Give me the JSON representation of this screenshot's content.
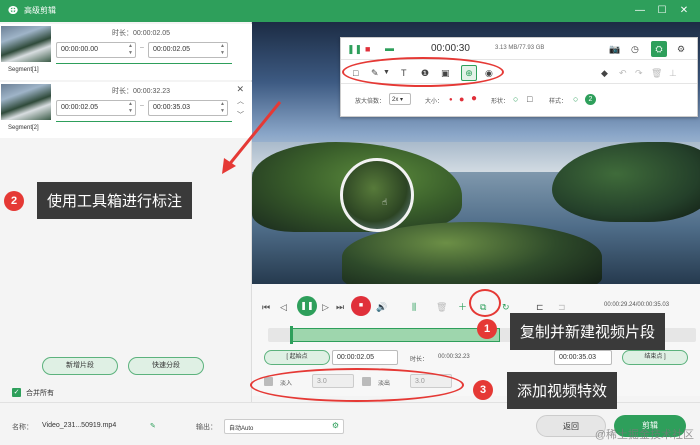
{
  "window": {
    "title": "高级剪辑"
  },
  "segments": [
    {
      "label": "Segment[1]",
      "duration_label": "时长：",
      "duration": "00:00:02.05",
      "start": "00:00:00.00",
      "end": "00:00:02.05"
    },
    {
      "label": "Segment[2]",
      "duration_label": "时长：",
      "duration": "00:00:32.23",
      "start": "00:00:02.05",
      "end": "00:00:35.03"
    }
  ],
  "left_buttons": {
    "new_segment": "新增片段",
    "quick_split": "快速分段"
  },
  "merge_all": "合并所有",
  "recorder": {
    "time": "00:00:30",
    "size": "3.13 MB/77.93 GB"
  },
  "annotation_options": {
    "zoom_label": "放大倍数：",
    "zoom_value": "2x",
    "size_label": "大小：",
    "shape_label": "形状：",
    "style_label": "样式：",
    "style_value": "2"
  },
  "playback": {
    "timecode": "00:00:29.24/00:00:35.03"
  },
  "trim": {
    "start_button": "起始点",
    "start_value": "00:00:02.05",
    "duration_label": "时长：",
    "duration_value": "00:00:32.23",
    "end_value": "00:00:35.03",
    "end_button": "结束点"
  },
  "effects": {
    "fade_in": "淡入",
    "fade_in_value": "3.0",
    "fade_out": "淡出",
    "fade_out_value": "3.0"
  },
  "bottom": {
    "name_label": "名称：",
    "name_value": "Video_231...50919.mp4",
    "output_label": "输出：",
    "output_value": "自动Auto",
    "back_button": "返回",
    "edit_button": "剪辑"
  },
  "annotations": [
    {
      "number": "1",
      "text": "复制并新建视频片段"
    },
    {
      "number": "2",
      "text": "使用工具箱进行标注"
    },
    {
      "number": "3",
      "text": "添加视频特效"
    }
  ],
  "watermark": "@稀土掘金技术社区",
  "colors": {
    "brand": "#2e9f5b",
    "annotation": "#e53935",
    "callout_bg": "#3a3a3a"
  }
}
